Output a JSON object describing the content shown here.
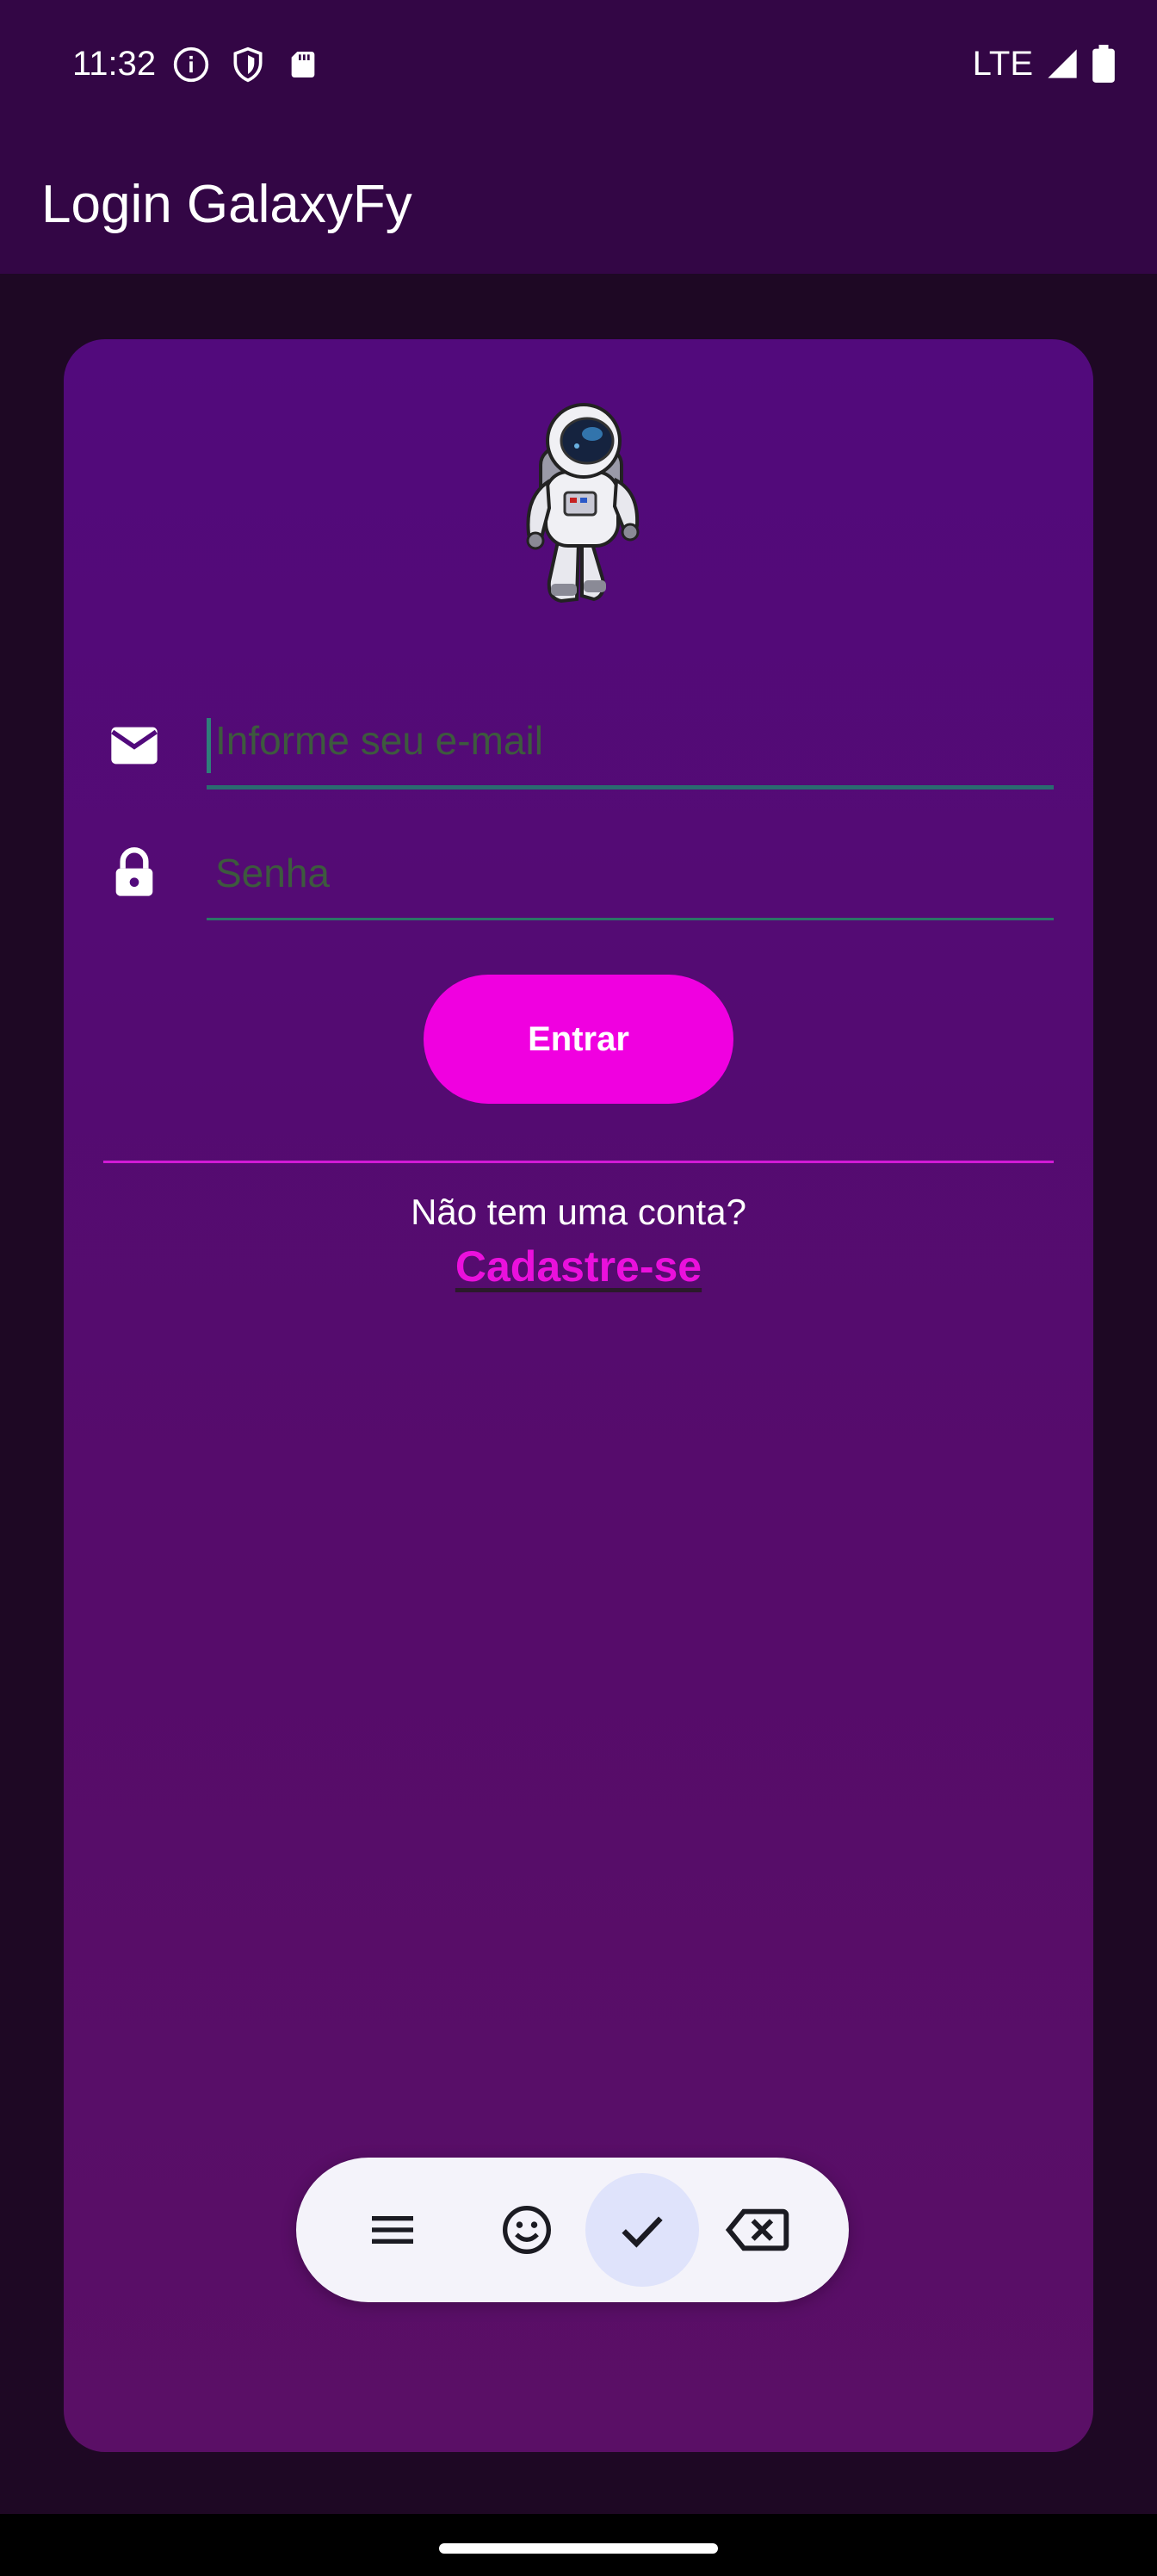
{
  "status_bar": {
    "time": "11:32",
    "network": "LTE",
    "icons": [
      "info-icon",
      "shield-icon",
      "sd-card-icon",
      "signal-icon",
      "battery-icon"
    ]
  },
  "app_bar": {
    "title": "Login GalaxyFy",
    "background": "#330645"
  },
  "login_card": {
    "logo": "astronaut-logo",
    "email_field": {
      "placeholder": "Informe seu e-mail",
      "value": "",
      "icon": "mail-icon"
    },
    "password_field": {
      "placeholder": "Senha",
      "value": "",
      "icon": "lock-icon"
    },
    "submit_label": "Entrar",
    "no_account_text": "Não tem uma conta?",
    "signup_label": "Cadastre-se",
    "accent": "#f000e0"
  },
  "keyboard_toolbar": {
    "buttons": [
      "menu-icon",
      "emoji-icon",
      "check-icon",
      "backspace-icon"
    ],
    "active": "check-icon"
  }
}
